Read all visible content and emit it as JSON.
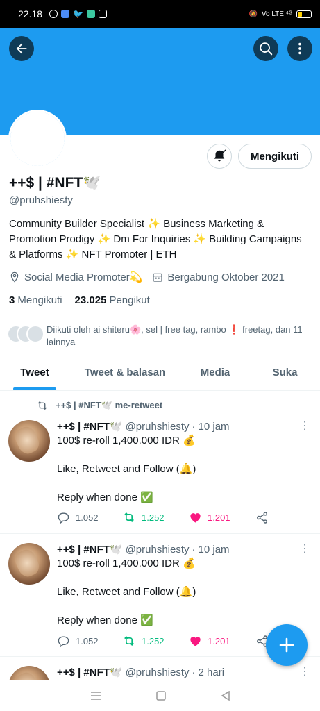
{
  "status_bar": {
    "time": "22.18",
    "right_text": "Vo LTE ⁴ᴳ",
    "battery_level": 0.35
  },
  "header": {
    "back_icon": "arrow-left-icon",
    "search_icon": "search-icon",
    "more_icon": "more-vertical-icon",
    "banner_color": "#1d9bf0"
  },
  "profile": {
    "display_name": "++$ | #NFT🕊️",
    "handle": "@pruhshiesty",
    "bio": "Community Builder Specialist ✨ Business Marketing & Promotion Prodigy ✨ Dm For Inquiries ✨ Building Campaigns & Platforms ✨ NFT Promoter | ETH",
    "location": "Social Media Promoter💫",
    "joined": "Bergabung Oktober 2021",
    "following_count": "3",
    "following_label": "Mengikuti",
    "followers_count": "23.025",
    "followers_label": "Pengikut",
    "followed_by": "Diikuti oleh ai shiteru🌸, sel | free tag, rambo ❗ freetag, dan 11 lainnya",
    "follow_button_label": "Mengikuti"
  },
  "tabs": [
    {
      "label": "Tweet",
      "active": true
    },
    {
      "label": "Tweet & balasan",
      "active": false
    },
    {
      "label": "Media",
      "active": false
    },
    {
      "label": "Suka",
      "active": false
    }
  ],
  "retweet_note": "++$ | #NFT🕊️ me-retweet",
  "tweets": [
    {
      "name": "++$ | #NFT🕊️",
      "handle": "@pruhshiesty",
      "dot": "·",
      "time": "10 jam",
      "line1": "100$ re-roll 1,400.000 IDR 💰",
      "line2": "Like, Retweet and Follow (🔔)",
      "line3": "Reply when done ✅",
      "replies": "1.052",
      "retweets": "1.252",
      "likes": "1.201"
    },
    {
      "name": "++$ | #NFT🕊️",
      "handle": "@pruhshiesty",
      "dot": "·",
      "time": "10 jam",
      "line1": "100$ re-roll 1,400.000 IDR 💰",
      "line2": "Like, Retweet and Follow (🔔)",
      "line3": "Reply when done ✅",
      "replies": "1.052",
      "retweets": "1.252",
      "likes": "1.201"
    },
    {
      "name": "++$ | #NFT🕊️",
      "handle": "@pruhshiesty",
      "dot": "·",
      "time": "2 hari"
    }
  ],
  "colors": {
    "accent": "#1d9bf0",
    "retweet": "#00ba7c",
    "like": "#f91880",
    "muted": "#536471"
  }
}
